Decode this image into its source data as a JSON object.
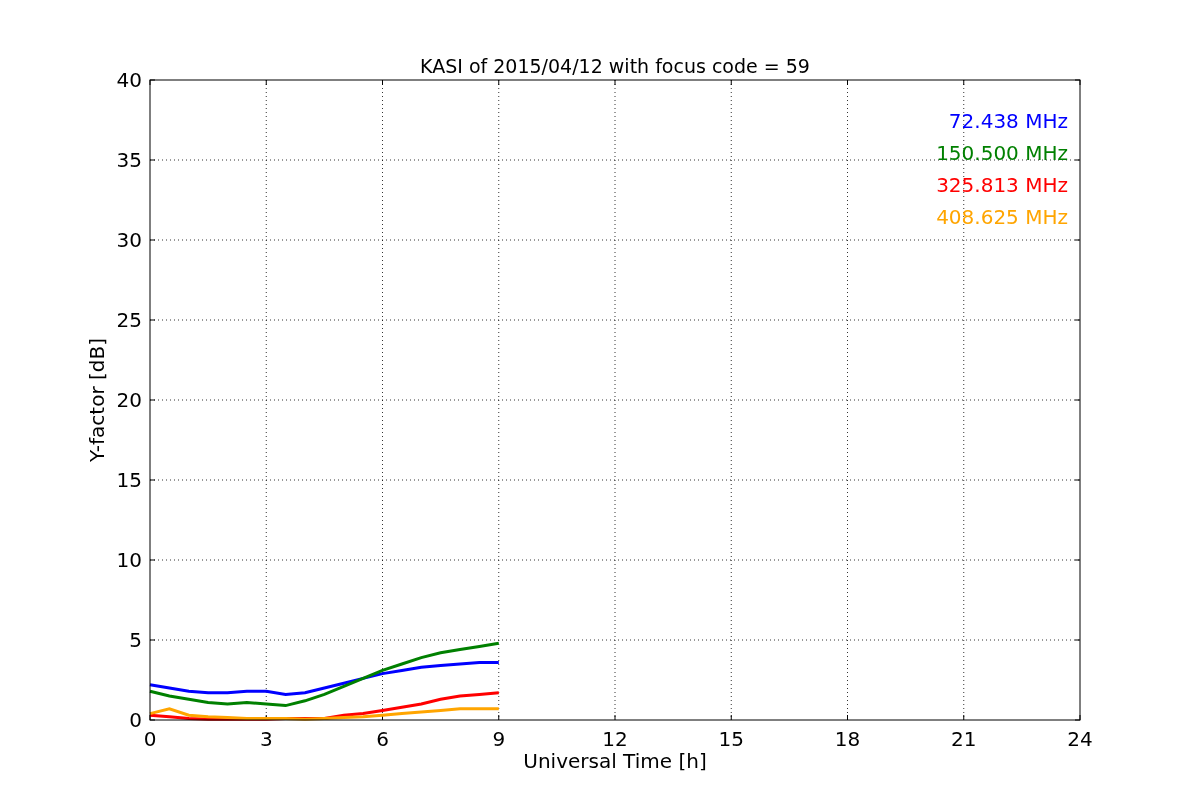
{
  "chart_data": {
    "type": "line",
    "title": "KASI of 2015/04/12 with focus code = 59",
    "xlabel": "Universal Time [h]",
    "ylabel": "Y-factor [dB]",
    "x": [
      0,
      0.5,
      1,
      1.5,
      2,
      2.5,
      3,
      3.5,
      4,
      4.5,
      5,
      5.5,
      6,
      6.5,
      7,
      7.5,
      8,
      8.5,
      9
    ],
    "series": [
      {
        "name": "72.438 MHz",
        "color": "#0000ff",
        "values": [
          2.2,
          2.0,
          1.8,
          1.7,
          1.7,
          1.8,
          1.8,
          1.6,
          1.7,
          2.0,
          2.3,
          2.6,
          2.9,
          3.1,
          3.3,
          3.4,
          3.5,
          3.6,
          3.6
        ]
      },
      {
        "name": "150.500 MHz",
        "color": "#008000",
        "values": [
          1.8,
          1.5,
          1.3,
          1.1,
          1.0,
          1.1,
          1.0,
          0.9,
          1.2,
          1.6,
          2.1,
          2.6,
          3.1,
          3.5,
          3.9,
          4.2,
          4.4,
          4.6,
          4.8
        ]
      },
      {
        "name": "325.813 MHz",
        "color": "#ff0000",
        "values": [
          0.3,
          0.2,
          0.1,
          0.05,
          0.05,
          0.05,
          0.05,
          0.1,
          0.1,
          0.1,
          0.3,
          0.4,
          0.6,
          0.8,
          1.0,
          1.3,
          1.5,
          1.6,
          1.7
        ]
      },
      {
        "name": "408.625 MHz",
        "color": "#ffa500",
        "values": [
          0.4,
          0.7,
          0.3,
          0.2,
          0.15,
          0.1,
          0.1,
          0.1,
          0.05,
          0.1,
          0.15,
          0.2,
          0.3,
          0.4,
          0.5,
          0.6,
          0.7,
          0.7,
          0.7
        ]
      }
    ],
    "grid": true,
    "xlim": [
      0,
      24
    ],
    "ylim": [
      0,
      40
    ],
    "xticks": [
      0,
      3,
      6,
      9,
      12,
      15,
      18,
      21,
      24
    ],
    "yticks": [
      0,
      5,
      10,
      15,
      20,
      25,
      30,
      35,
      40
    ]
  }
}
